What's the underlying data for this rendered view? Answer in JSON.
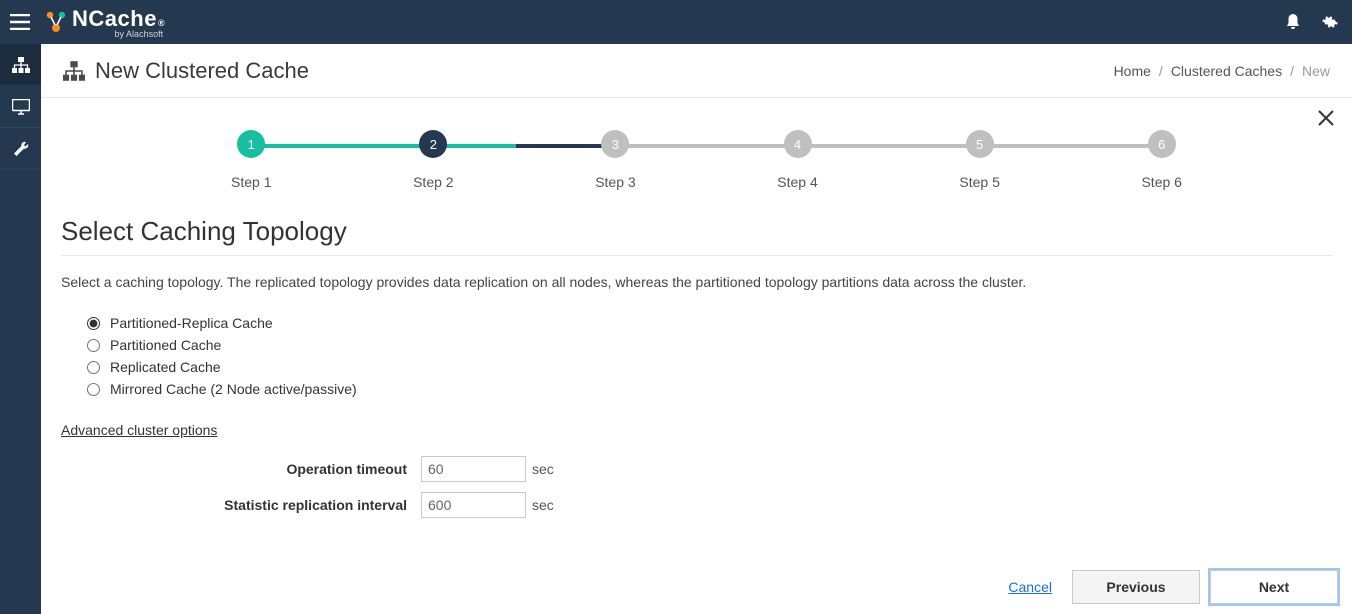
{
  "topbar": {
    "product_name_prefix": "N",
    "product_name_rest": "Cache",
    "byline": "by Alachsoft"
  },
  "header": {
    "title": "New Clustered Cache",
    "breadcrumb": {
      "home": "Home",
      "parent": "Clustered Caches",
      "current": "New"
    }
  },
  "stepper": {
    "steps": [
      {
        "num": "1",
        "label": "Step 1",
        "state": "done"
      },
      {
        "num": "2",
        "label": "Step 2",
        "state": "active"
      },
      {
        "num": "3",
        "label": "Step 3",
        "state": "pending"
      },
      {
        "num": "4",
        "label": "Step 4",
        "state": "pending"
      },
      {
        "num": "5",
        "label": "Step 5",
        "state": "pending"
      },
      {
        "num": "6",
        "label": "Step 6",
        "state": "pending"
      }
    ]
  },
  "section": {
    "title": "Select Caching Topology",
    "description": "Select a caching topology. The replicated topology provides data replication on all nodes, whereas the partitioned topology partitions data across the cluster."
  },
  "topologies": [
    {
      "label": "Partitioned-Replica Cache",
      "selected": true
    },
    {
      "label": "Partitioned Cache",
      "selected": false
    },
    {
      "label": "Replicated Cache",
      "selected": false
    },
    {
      "label": "Mirrored Cache (2 Node active/passive)",
      "selected": false
    }
  ],
  "advanced_label": "Advanced cluster options",
  "form": {
    "op_timeout_label": "Operation timeout",
    "op_timeout_value": "60",
    "op_timeout_unit": "sec",
    "stat_interval_label": "Statistic replication interval",
    "stat_interval_value": "600",
    "stat_interval_unit": "sec"
  },
  "footer": {
    "cancel": "Cancel",
    "previous": "Previous",
    "next": "Next"
  }
}
